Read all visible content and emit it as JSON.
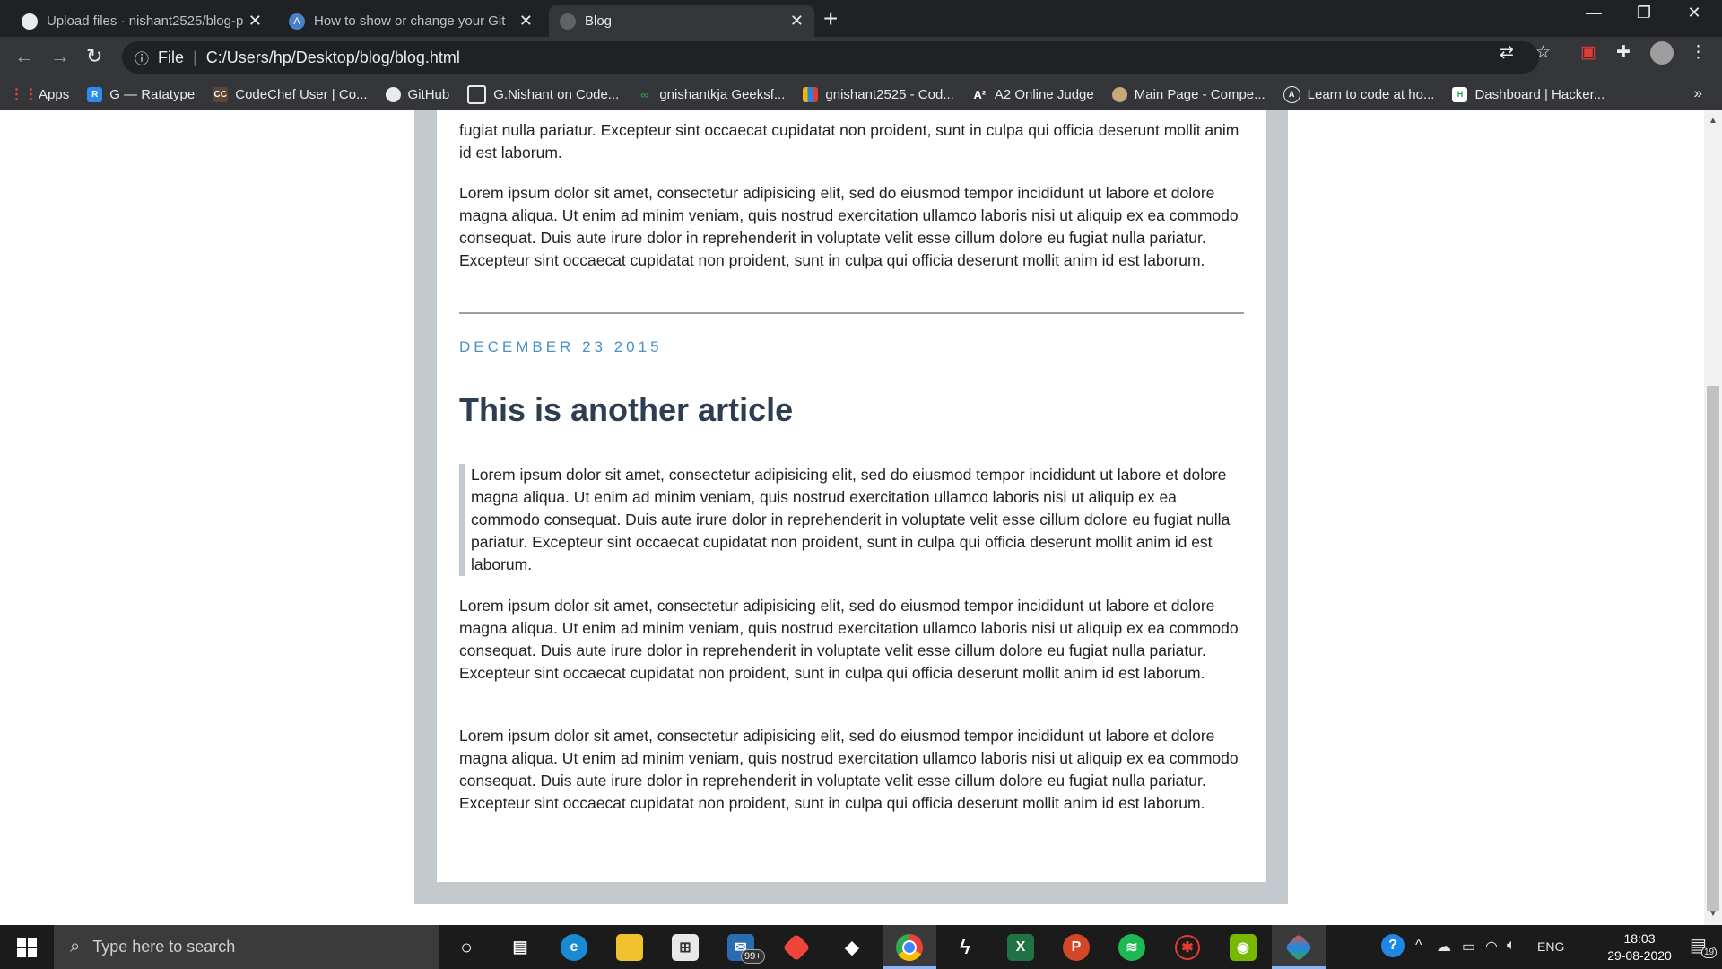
{
  "tabs": [
    {
      "title": "Upload files · nishant2525/blog-p",
      "icon": "github-icon",
      "active": false
    },
    {
      "title": "How to show or change your Git",
      "icon": "a-circle-icon",
      "active": false
    },
    {
      "title": "Blog",
      "icon": "globe-icon",
      "active": true
    }
  ],
  "toolbar": {
    "scheme_label": "File",
    "url": "C:/Users/hp/Desktop/blog/blog.html"
  },
  "bookmarks": [
    {
      "label": "Apps",
      "icon": "apps-grid-icon",
      "color": "#ea4335"
    },
    {
      "label": "G — Ratatype",
      "icon": "ratatype-icon",
      "color": "#2d8cf0"
    },
    {
      "label": "CodeChef User | Co...",
      "icon": "codechef-icon",
      "color": "#5b4638"
    },
    {
      "label": "GitHub",
      "icon": "github-icon",
      "color": "#ffffff"
    },
    {
      "label": "G.Nishant on Code...",
      "icon": "codeforces-icon",
      "color": "#ffffff"
    },
    {
      "label": "gnishantkja Geeksf...",
      "icon": "geeksforgeeks-icon",
      "color": "#2f8d46"
    },
    {
      "label": "gnishant2525 - Cod...",
      "icon": "codeforces-bars-icon",
      "color": "#f4b400"
    },
    {
      "label": "A2 Online Judge",
      "icon": "a2-icon",
      "color": "#ffffff"
    },
    {
      "label": "Main Page - Compe...",
      "icon": "wiki-icon",
      "color": "#c9a878"
    },
    {
      "label": "Learn to code at ho...",
      "icon": "atcoder-icon",
      "color": "#ffffff"
    },
    {
      "label": "Dashboard | Hacker...",
      "icon": "hackerrank-icon",
      "color": "#ffffff"
    }
  ],
  "content": {
    "lorem": "Lorem ipsum dolor sit amet, consectetur adipisicing elit, sed do eiusmod tempor incididunt ut labore et dolore magna aliqua. Ut enim ad minim veniam, quis nostrud exercitation ullamco laboris nisi ut aliquip ex ea commodo consequat. Duis aute irure dolor in reprehenderit in voluptate velit esse cillum dolore eu fugiat nulla pariatur. Excepteur sint occaecat cupidatat non proident, sunt in culpa qui officia deserunt mollit anim id est laborum.",
    "partial_top": "fugiat nulla pariatur. Excepteur sint occaecat cupidatat non proident, sunt in culpa qui officia deserunt mollit anim id est laborum.",
    "date": "DECEMBER 23 2015",
    "title": "This is another article",
    "date_color": "#4a90c9",
    "title_color": "#2c3e50"
  },
  "taskbar": {
    "search_placeholder": "Type here to search",
    "store_badge": "99+",
    "language": "ENG",
    "time": "18:03",
    "date": "29-08-2020",
    "notifications": "19",
    "apps": [
      "cortana-icon",
      "task-view-icon",
      "edge-icon",
      "file-explorer-icon",
      "store-icon",
      "mail-icon",
      "anydesk-icon",
      "dropbox-icon",
      "chrome-icon",
      "sublime-icon",
      "excel-icon",
      "powerpoint-icon",
      "spotify-icon",
      "antivirus-icon",
      "nvidia-icon",
      "git-icon"
    ]
  }
}
